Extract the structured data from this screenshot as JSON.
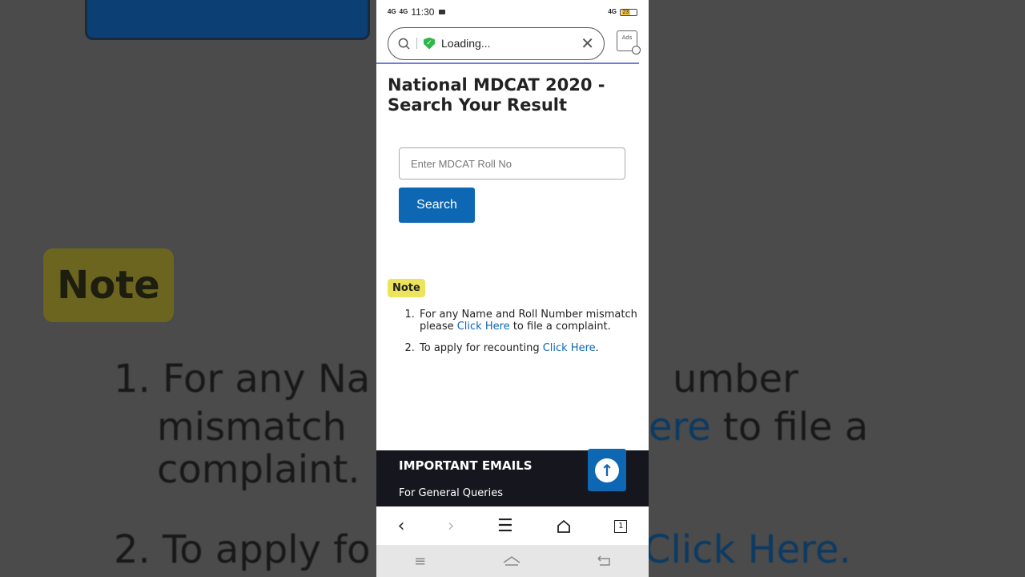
{
  "background": {
    "note_label": "Note",
    "line1_a": "1. For any Na",
    "line1_b": "umber",
    "line2_a": "mismatch",
    "line2_link": "ere",
    "line2_b": " to file a",
    "line3": "complaint.",
    "line4_a": "2. To apply fo",
    "line4_link": "Click Here."
  },
  "status_bar": {
    "network1": "4G",
    "network2": "4G",
    "time": "11:30",
    "network3": "4G",
    "battery": "23"
  },
  "browser": {
    "url_text": "Loading...",
    "ads_label": "Ads"
  },
  "page": {
    "title": "National MDCAT 2020 - Search Your Result",
    "roll_placeholder": "Enter MDCAT Roll No",
    "search_label": "Search",
    "note_label": "Note",
    "notes": [
      {
        "before": "For any Name and Roll Number mismatch please ",
        "link": "Click Here",
        "after": " to file a complaint."
      },
      {
        "before": "To apply for recounting ",
        "link": "Click Here",
        "after": "."
      }
    ]
  },
  "footer": {
    "heading": "IMPORTANT EMAILS",
    "sub": "For General Queries"
  },
  "nav": {
    "tab_count": "1"
  },
  "colors": {
    "accent": "#0d67b3",
    "note_badge": "#ece45a",
    "footer_bg": "#16161f"
  }
}
